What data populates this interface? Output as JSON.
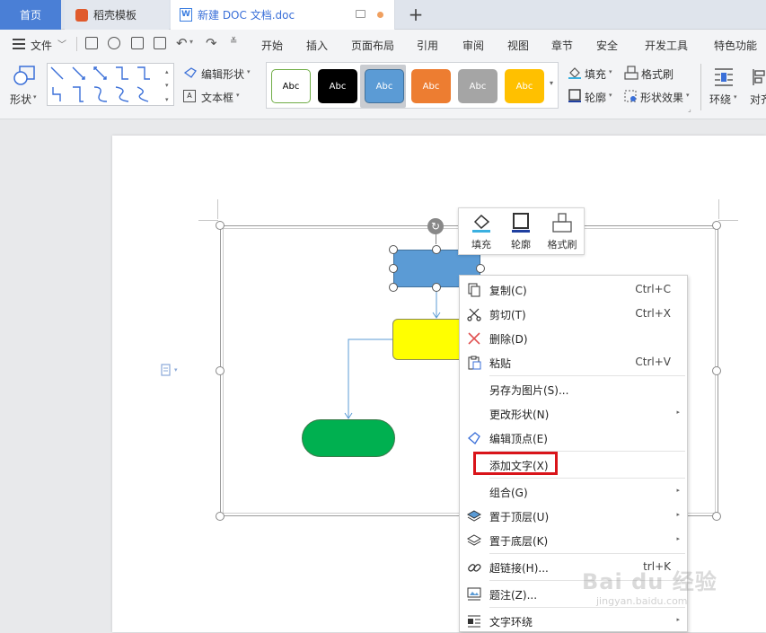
{
  "tabs": {
    "home": "首页",
    "template": "稻壳模板",
    "document": "新建 DOC 文档.doc",
    "add": "+"
  },
  "menu": {
    "file": "文件",
    "items": [
      "开始",
      "插入",
      "页面布局",
      "引用",
      "审阅",
      "视图",
      "章节",
      "安全",
      "开发工具",
      "特色功能"
    ]
  },
  "ribbon": {
    "shapes": "形状",
    "edit_shape": "编辑形状",
    "textbox": "文本框",
    "styles": [
      "Abc",
      "Abc",
      "Abc",
      "Abc",
      "Abc",
      "Abc"
    ],
    "fill": "填充",
    "outline": "轮廓",
    "format_painter": "格式刷",
    "shape_effect": "形状效果",
    "wrap": "环绕",
    "align": "对齐"
  },
  "mini_toolbar": {
    "fill": "填充",
    "outline": "轮廓",
    "format_painter": "格式刷"
  },
  "context_menu": {
    "copy": {
      "label": "复制(C)",
      "shortcut": "Ctrl+C"
    },
    "cut": {
      "label": "剪切(T)",
      "shortcut": "Ctrl+X"
    },
    "delete": {
      "label": "删除(D)"
    },
    "paste": {
      "label": "粘贴",
      "shortcut": "Ctrl+V"
    },
    "save_as_picture": {
      "label": "另存为图片(S)..."
    },
    "change_shape": {
      "label": "更改形状(N)"
    },
    "edit_points": {
      "label": "编辑顶点(E)"
    },
    "add_text": {
      "label": "添加文字(X)"
    },
    "group": {
      "label": "组合(G)"
    },
    "bring_to_front": {
      "label": "置于顶层(U)"
    },
    "send_to_back": {
      "label": "置于底层(K)"
    },
    "hyperlink": {
      "label": "超链接(H)...",
      "shortcut": "trl+K"
    },
    "caption": {
      "label": "题注(Z)..."
    },
    "text_wrap": {
      "label": "文字环绕"
    }
  },
  "watermark": {
    "brand": "Bai du 经验",
    "url": "jingyan.baidu.com"
  },
  "colors": {
    "accent": "#4a7fd6",
    "blue_shape": "#5b9bd5",
    "yellow_shape": "#ffff00",
    "green_shape": "#00b050",
    "highlight": "#d9141a"
  }
}
